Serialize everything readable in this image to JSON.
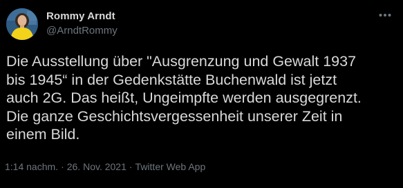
{
  "tweet": {
    "author": {
      "display_name": "Rommy Arndt",
      "handle": "@ArndtRommy"
    },
    "text": "Die Ausstellung über \"Ausgrenzung und Gewalt 1937\nbis 1945“ in der Gedenkstätte Buchenwald ist jetzt\nauch 2G. Das heißt, Ungeimpfte werden ausgegrenzt.\nDie ganze Geschichtsvergessenheit unserer Zeit in\neinem Bild.",
    "time": "1:14 nachm.",
    "separator": "·",
    "date": "26. Nov. 2021",
    "source": "Twitter Web App"
  },
  "icons": {
    "more": "more-horizontal-icon"
  },
  "colors": {
    "background": "#000000",
    "primary_text": "#d9d9d9",
    "secondary_text": "#6e767d"
  }
}
